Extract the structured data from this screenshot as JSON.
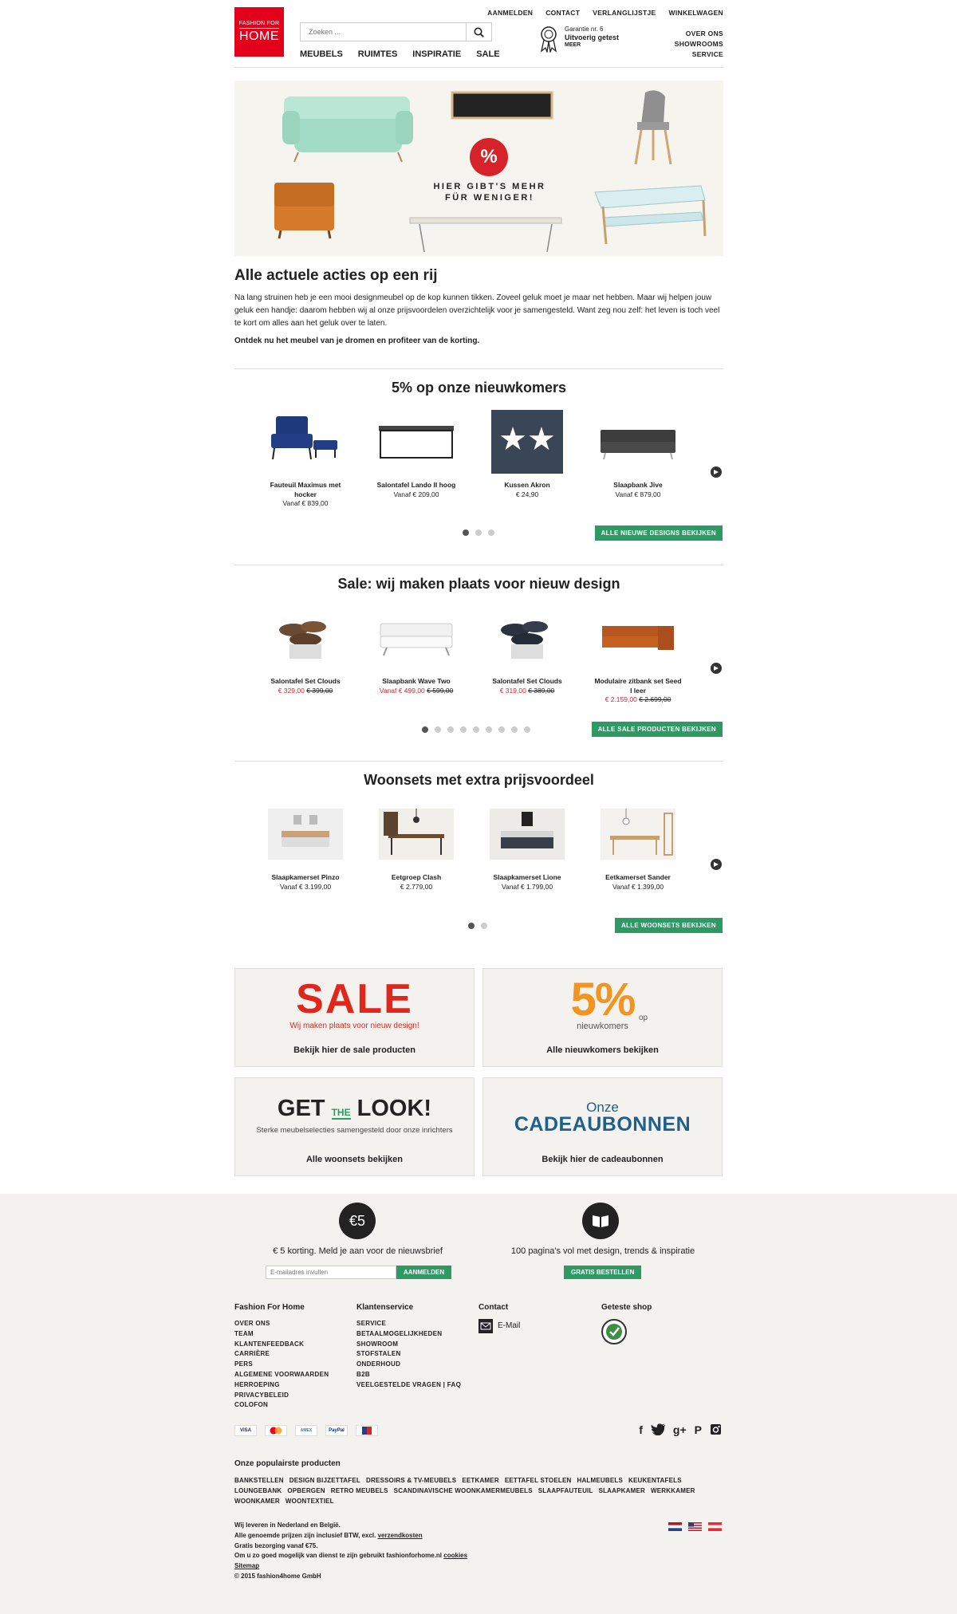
{
  "header": {
    "logo_line1": "FASHION FOR",
    "logo_line2": "HOME",
    "search_placeholder": "Zoeken ...",
    "top_links": [
      "AANMELDEN",
      "CONTACT",
      "VERLANGLIJSTJE",
      "WINKELWAGEN"
    ],
    "main_nav": [
      "MEUBELS",
      "RUIMTES",
      "INSPIRATIE",
      "SALE"
    ],
    "guarantee_line1": "Garantie nr. 6",
    "guarantee_line2": "Uitvoerig getest",
    "guarantee_more": "MEER",
    "right_links": [
      "OVER ONS",
      "SHOWROOMS",
      "SERVICE"
    ]
  },
  "hero": {
    "badge": "%",
    "text_line1": "HIER GIBT'S MEHR",
    "text_line2": "FÜR WENIGER!"
  },
  "intro": {
    "title": "Alle actuele acties op een rij",
    "text": "Na lang struinen heb je een mooi designmeubel op de kop kunnen tikken. Zoveel geluk moet je maar net hebben. Maar wij helpen jouw geluk een handje: daarom hebben wij al onze prijsvoordelen overzichtelijk voor je samengesteld. Want zeg nou zelf: het leven is toch veel te kort om alles aan het geluk over te laten.",
    "cta": "Ontdek nu het meubel van je dromen en profiteer van de korting."
  },
  "sections": [
    {
      "title": "5% op onze nieuwkomers",
      "button": "ALLE NIEUWE DESIGNS BEKIJKEN",
      "products": [
        {
          "name": "Fauteuil Maximus met hocker",
          "price": "Vanaf € 839,00",
          "old": ""
        },
        {
          "name": "Salontafel Lando II hoog",
          "price": "Vanaf € 209,00",
          "old": ""
        },
        {
          "name": "Kussen Akron",
          "price": "€ 24,90",
          "old": ""
        },
        {
          "name": "Slaapbank Jive",
          "price": "Vanaf € 879,00",
          "old": ""
        }
      ]
    },
    {
      "title": "Sale: wij maken plaats voor nieuw design",
      "button": "ALLE SALE PRODUCTEN BEKIJKEN",
      "products": [
        {
          "name": "Salontafel Set Clouds",
          "price": "€ 329,00",
          "old": "€ 399,00"
        },
        {
          "name": "Slaapbank Wave Two",
          "price": "Vanaf € 499,00",
          "old": "€ 599,00"
        },
        {
          "name": "Salontafel Set Clouds",
          "price": "€ 319,00",
          "old": "€ 389,00"
        },
        {
          "name": "Modulaire zitbank set Seed I leer",
          "price": "€ 2.159,00",
          "old": "€ 2.699,00"
        }
      ]
    },
    {
      "title": "Woonsets met extra prijsvoordeel",
      "button": "ALLE WOONSETS BEKIJKEN",
      "products": [
        {
          "name": "Slaapkamerset Pinzo",
          "price": "Vanaf € 3.199,00",
          "old": ""
        },
        {
          "name": "Eetgroep Clash",
          "price": "€ 2.779,00",
          "old": ""
        },
        {
          "name": "Slaapkamerset Lione",
          "price": "Vanaf € 1.799,00",
          "old": ""
        },
        {
          "name": "Eetkamerset Sander",
          "price": "Vanaf € 1.399,00",
          "old": ""
        }
      ]
    }
  ],
  "tiles": {
    "sale_big": "SALE",
    "sale_sub": "Wij maken plaats voor nieuw design!",
    "sale_cap": "Bekijk hier de sale producten",
    "new_big": "5%",
    "new_op": "op",
    "new_sub": "nieuwkomers",
    "new_cap": "Alle nieuwkomers bekijken",
    "look_get": "GET",
    "look_the": "THE",
    "look_look": "LOOK!",
    "look_sub": "Sterke meubelselecties samengesteld door onze inrichters",
    "look_cap": "Alle woonsets bekijken",
    "gift_onze": "Onze",
    "gift_big": "CADEAUBONNEN",
    "gift_cap": "Bekijk hier de cadeaubonnen"
  },
  "footer": {
    "newsletter_badge": "€5",
    "newsletter_text": "€ 5 korting. Meld je aan voor de nieuwsbrief",
    "email_placeholder": "E-mailadres invullen",
    "newsletter_button": "AANMELDEN",
    "catalog_text": "100 pagina's vol met design, trends & inspiratie",
    "catalog_button": "GRATIS BESTELLEN",
    "col1_title": "Fashion For Home",
    "col1_links": [
      "OVER ONS",
      "TEAM",
      "KLANTENFEEDBACK",
      "CARRIÈRE",
      "PERS",
      "ALGEMENE VOORWAARDEN",
      "HERROEPING",
      "PRIVACYBELEID",
      "COLOFON"
    ],
    "col2_title": "Klantenservice",
    "col2_links": [
      "SERVICE",
      "BETAALMOGELIJKHEDEN",
      "SHOWROOM",
      "STOFSTALEN",
      "ONDERHOUD",
      "B2B",
      "VEELGESTELDE VRAGEN | FAQ"
    ],
    "col3_title": "Contact",
    "email_label": "E-Mail",
    "col4_title": "Geteste shop",
    "payments": [
      "VISA",
      "MC",
      "AMEX",
      "PayPal",
      "ELV"
    ],
    "popular_title": "Onze populairste producten",
    "popular": [
      "BANKSTELLEN",
      "DESIGN BIJZETTAFEL",
      "DRESSOIRS & TV-MEUBELS",
      "EETKAMER",
      "EETTAFEL STOELEN",
      "HALMEUBELS",
      "KEUKENTAFELS",
      "LOUNGEBANK",
      "OPBERGEN",
      "RETRO MEUBELS",
      "SCANDINAVISCHE WOONKAMERMEUBELS",
      "SLAAPFAUTEUIL",
      "SLAAPKAMER",
      "WERKKAMER",
      "WOONKAMER",
      "WOONTEXTIEL"
    ],
    "legal1": "Wij leveren in Nederland en België.",
    "legal2a": "Alle genoemde prijzen zijn inclusief BTW, excl.",
    "legal2b": "verzendkosten",
    "legal3": "Gratis bezorging vanaf €75.",
    "legal4a": "Om u zo goed mogelijk van dienst te zijn gebruikt fashionforhome.nl",
    "legal4b": "cookies",
    "legal5": "Sitemap",
    "legal6": "© 2015 fashion4home GmbH"
  }
}
